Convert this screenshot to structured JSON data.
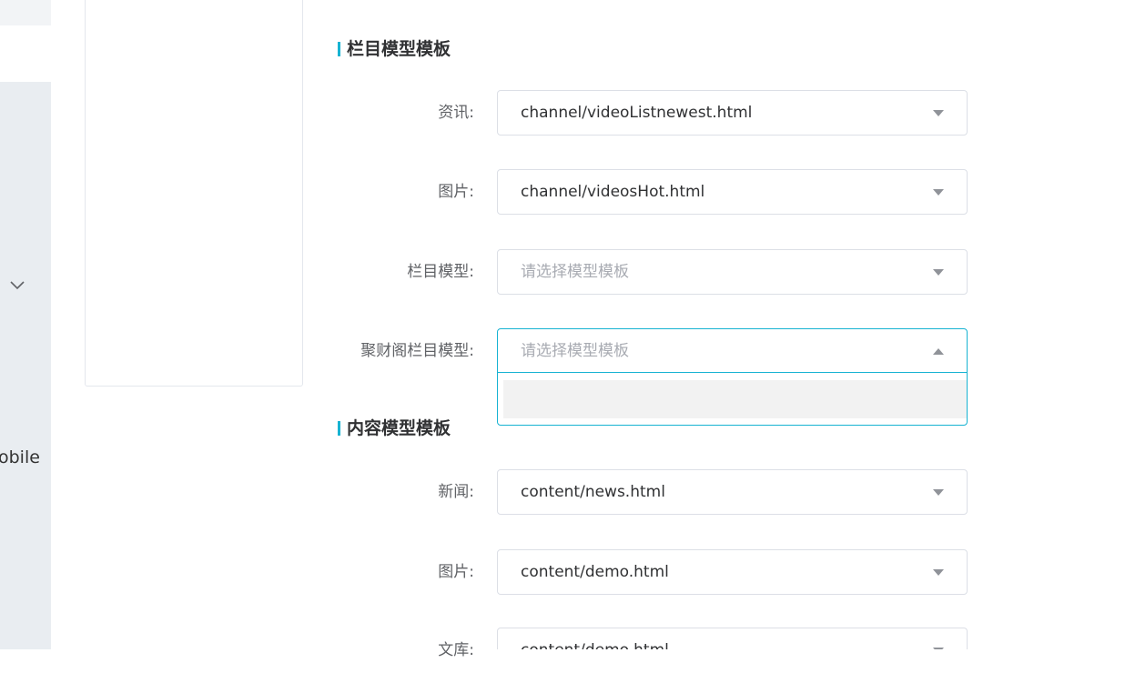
{
  "sidebar": {
    "label": "obile"
  },
  "channel_section": {
    "title": "栏目模型模板",
    "rows": [
      {
        "label": "资讯:",
        "value": "channel/videoListnewest.html",
        "placeholder": false
      },
      {
        "label": "图片:",
        "value": "channel/videosHot.html",
        "placeholder": false
      },
      {
        "label": "栏目模型:",
        "value": "请选择模型模板",
        "placeholder": true
      },
      {
        "label": "聚财阁栏目模型:",
        "value": "请选择模型模板",
        "placeholder": true
      }
    ]
  },
  "content_section": {
    "title": "内容模型模板",
    "rows": [
      {
        "label": "新闻:",
        "value": "content/news.html",
        "placeholder": false
      },
      {
        "label": "图片:",
        "value": "content/demo.html",
        "placeholder": false
      },
      {
        "label": "文库:",
        "value": "content/demo.html",
        "placeholder": false
      }
    ]
  },
  "colors": {
    "accent": "#17b3d2",
    "sidebar_bg": "#e9edf1"
  }
}
